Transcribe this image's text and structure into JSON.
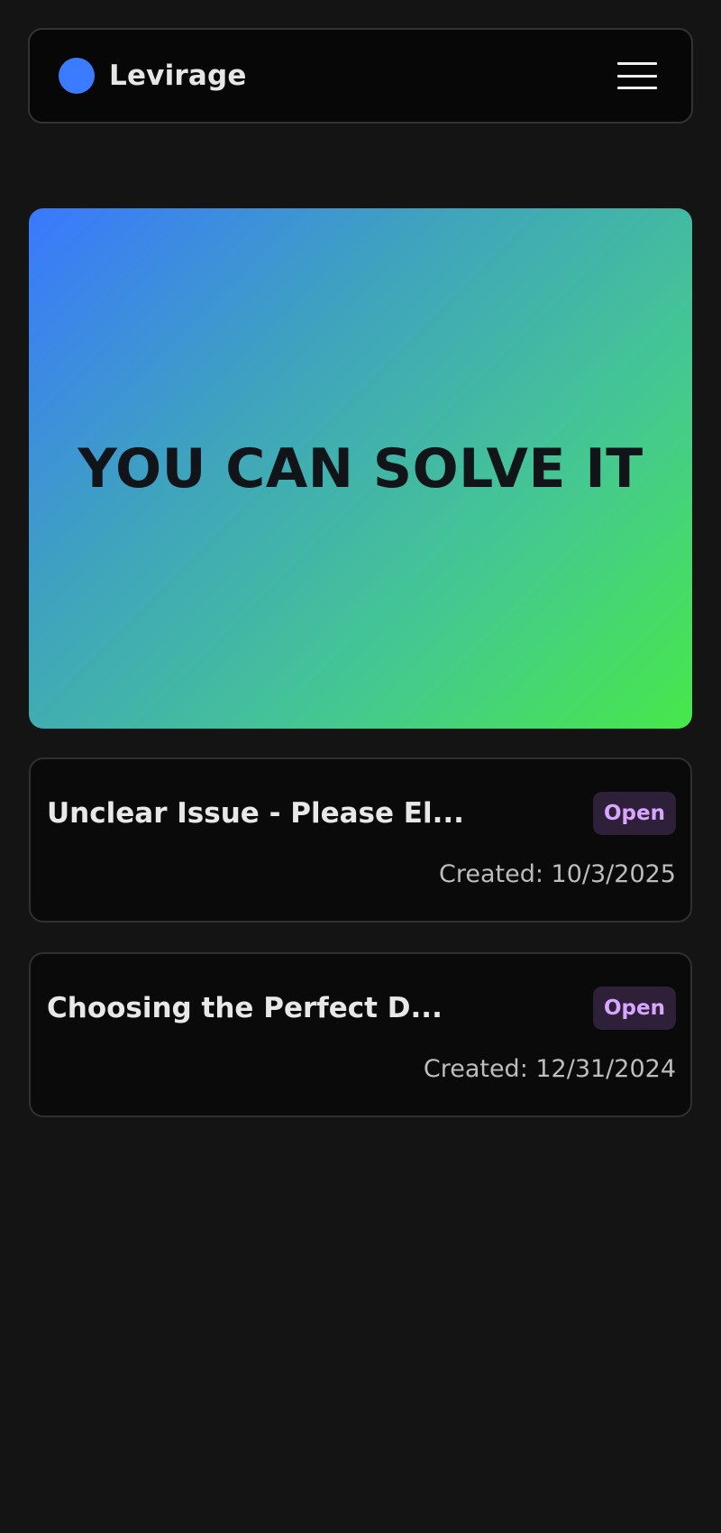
{
  "header": {
    "brand_name": "Levirage",
    "logo_color": "#3b7bff",
    "menu_icon": "hamburger-menu-icon"
  },
  "hero": {
    "title": "YOU CAN SOLVE IT",
    "gradient_colors": [
      "#3a78ff",
      "#46e84a"
    ]
  },
  "issues": [
    {
      "title": "Unclear Issue - Please El...",
      "status": "Open",
      "created": "Created: 10/3/2025"
    },
    {
      "title": "Choosing the Perfect D...",
      "status": "Open",
      "created": "Created: 12/31/2024"
    }
  ]
}
